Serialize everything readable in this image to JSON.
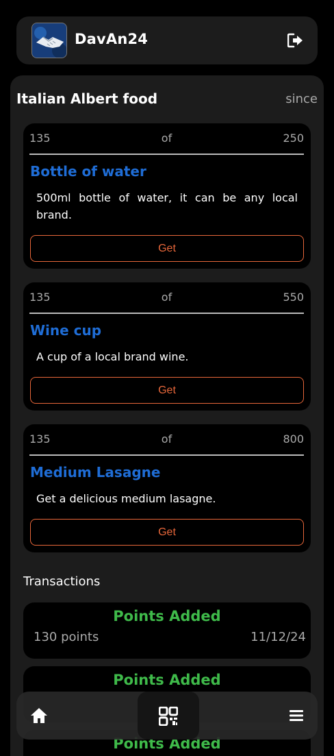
{
  "header": {
    "username": "DavAn24",
    "avatar_icon": "handshake-icon",
    "logout_icon": "logout-icon"
  },
  "store": {
    "name": "Italian Albert food",
    "since_label": "since"
  },
  "rewards": [
    {
      "current": "135",
      "of_label": "of",
      "total": "250",
      "title": "Bottle of water",
      "description": "500ml bottle of water, it can be any local brand.",
      "button_label": "Get"
    },
    {
      "current": "135",
      "of_label": "of",
      "total": "550",
      "title": "Wine cup",
      "description": "A cup of a local brand wine.",
      "button_label": "Get"
    },
    {
      "current": "135",
      "of_label": "of",
      "total": "800",
      "title": "Medium Lasagne",
      "description": "Get a delicious medium lasagne.",
      "button_label": "Get"
    }
  ],
  "transactions": {
    "title": "Transactions",
    "items": [
      {
        "type": "Points Added",
        "points": "130 points",
        "date": "11/12/24"
      },
      {
        "type": "Points Added",
        "points": "",
        "date": ""
      },
      {
        "type": "Points Added",
        "points": "",
        "date": ""
      }
    ]
  },
  "bottom_nav": {
    "home_icon": "home-icon",
    "qr_icon": "qr-code-icon",
    "menu_icon": "hamburger-menu-icon"
  },
  "colors": {
    "background": "#000000",
    "panel": "#1c1c1c",
    "title_blue": "#1f6dd6",
    "button_orange": "#e8673a",
    "points_green": "#3fba4a",
    "muted_text": "#aaaaaa"
  }
}
